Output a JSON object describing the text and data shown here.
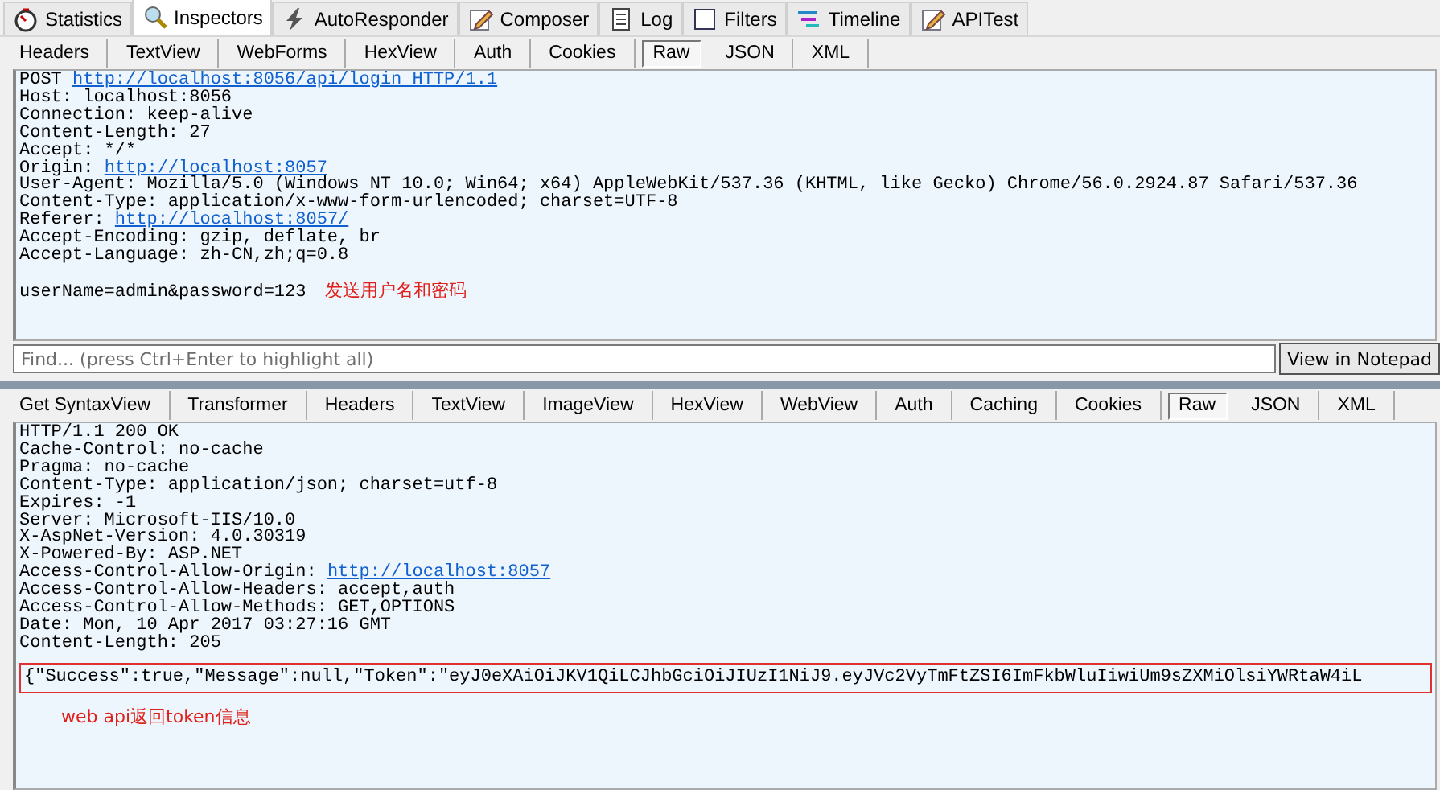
{
  "main_tabs": [
    {
      "label": "Statistics",
      "selected": false
    },
    {
      "label": "Inspectors",
      "selected": true
    },
    {
      "label": "AutoResponder",
      "selected": false
    },
    {
      "label": "Composer",
      "selected": false
    },
    {
      "label": "Log",
      "selected": false
    },
    {
      "label": "Filters",
      "selected": false
    },
    {
      "label": "Timeline",
      "selected": false
    },
    {
      "label": "APITest",
      "selected": false
    }
  ],
  "request": {
    "tabs": [
      {
        "label": "Headers",
        "selected": false
      },
      {
        "label": "TextView",
        "selected": false
      },
      {
        "label": "WebForms",
        "selected": false
      },
      {
        "label": "HexView",
        "selected": false
      },
      {
        "label": "Auth",
        "selected": false
      },
      {
        "label": "Cookies",
        "selected": false
      },
      {
        "label": "Raw",
        "selected": true
      },
      {
        "label": "JSON",
        "selected": false
      },
      {
        "label": "XML",
        "selected": false
      }
    ],
    "lines": [
      [
        {
          "text": "POST "
        },
        {
          "text": "http://localhost:8056/api/login HTTP/1.1",
          "link": true
        }
      ],
      [
        {
          "text": "Host: localhost:8056"
        }
      ],
      [
        {
          "text": "Connection: keep-alive"
        }
      ],
      [
        {
          "text": "Content-Length: 27"
        }
      ],
      [
        {
          "text": "Accept: */*"
        }
      ],
      [
        {
          "text": "Origin: "
        },
        {
          "text": "http://localhost:8057",
          "link": true
        }
      ],
      [
        {
          "text": "User-Agent: Mozilla/5.0 (Windows NT 10.0; Win64; x64) AppleWebKit/537.36 (KHTML, like Gecko) Chrome/56.0.2924.87 Safari/537.36"
        }
      ],
      [
        {
          "text": "Content-Type: application/x-www-form-urlencoded; charset=UTF-8"
        }
      ],
      [
        {
          "text": "Referer: "
        },
        {
          "text": "http://localhost:8057/",
          "link": true
        }
      ],
      [
        {
          "text": "Accept-Encoding: gzip, deflate, br"
        }
      ],
      [
        {
          "text": "Accept-Language: zh-CN,zh;q=0.8"
        }
      ],
      [
        {
          "text": "userName=admin&password=123"
        }
      ]
    ],
    "annotation": "发送用户名和密码",
    "find_placeholder": "Find... (press Ctrl+Enter to highlight all)",
    "notepad_button": "View in Notepad"
  },
  "response": {
    "tabs": [
      {
        "label": "Get SyntaxView",
        "selected": false
      },
      {
        "label": "Transformer",
        "selected": false
      },
      {
        "label": "Headers",
        "selected": false
      },
      {
        "label": "TextView",
        "selected": false
      },
      {
        "label": "ImageView",
        "selected": false
      },
      {
        "label": "HexView",
        "selected": false
      },
      {
        "label": "WebView",
        "selected": false
      },
      {
        "label": "Auth",
        "selected": false
      },
      {
        "label": "Caching",
        "selected": false
      },
      {
        "label": "Cookies",
        "selected": false
      },
      {
        "label": "Raw",
        "selected": true
      },
      {
        "label": "JSON",
        "selected": false
      },
      {
        "label": "XML",
        "selected": false
      }
    ],
    "lines": [
      [
        {
          "text": "HTTP/1.1 200 OK"
        }
      ],
      [
        {
          "text": "Cache-Control: no-cache"
        }
      ],
      [
        {
          "text": "Pragma: no-cache"
        }
      ],
      [
        {
          "text": "Content-Type: application/json; charset=utf-8"
        }
      ],
      [
        {
          "text": "Expires: -1"
        }
      ],
      [
        {
          "text": "Server: Microsoft-IIS/10.0"
        }
      ],
      [
        {
          "text": "X-AspNet-Version: 4.0.30319"
        }
      ],
      [
        {
          "text": "X-Powered-By: ASP.NET"
        }
      ],
      [
        {
          "text": "Access-Control-Allow-Origin: "
        },
        {
          "text": "http://localhost:8057",
          "link": true
        }
      ],
      [
        {
          "text": "Access-Control-Allow-Headers: accept,auth"
        }
      ],
      [
        {
          "text": "Access-Control-Allow-Methods: GET,OPTIONS"
        }
      ],
      [
        {
          "text": "Date: Mon, 10 Apr 2017 03:27:16 GMT"
        }
      ],
      [
        {
          "text": "Content-Length: 205"
        }
      ]
    ],
    "body": "{\"Success\":true,\"Message\":null,\"Token\":\"eyJ0eXAiOiJKV1QiLCJhbGciOiJIUzI1NiJ9.eyJVc2VyTmFtZSI6ImFkbWluIiwiUm9sZXMiOlsiYWRtaW4iL",
    "annotation": "web api返回token信息"
  }
}
